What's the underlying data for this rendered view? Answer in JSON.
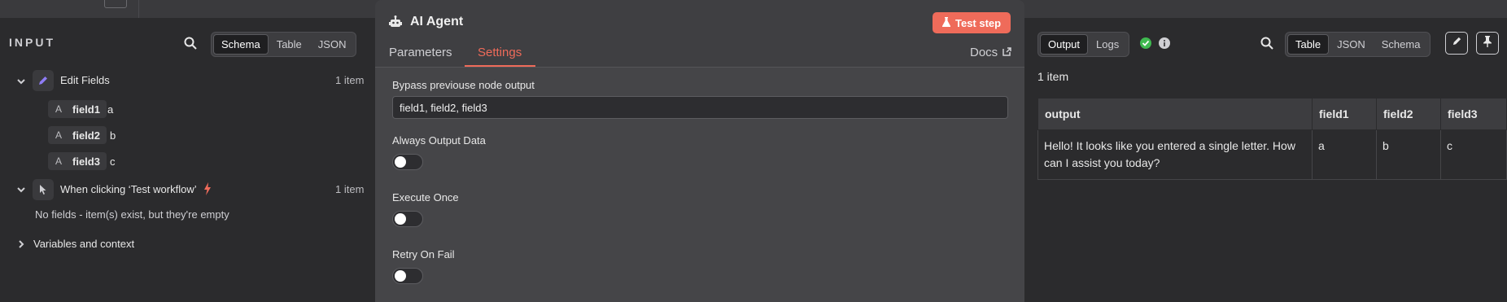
{
  "input_panel": {
    "title": "INPUT",
    "view_options": [
      "Schema",
      "Table",
      "JSON"
    ],
    "nodes": [
      {
        "name": "Edit Fields",
        "count": "1 item",
        "fields": [
          {
            "type": "A",
            "name": "field1",
            "value": "a"
          },
          {
            "type": "A",
            "name": "field2",
            "value": "b"
          },
          {
            "type": "A",
            "name": "field3",
            "value": "c"
          }
        ]
      },
      {
        "name": "When clicking ‘Test workflow’",
        "count": "1 item",
        "empty_message": "No fields - item(s) exist, but they're empty"
      }
    ],
    "variables_label": "Variables and context"
  },
  "node_modal": {
    "title": "AI Agent",
    "test_button": "Test step",
    "tabs": [
      "Parameters",
      "Settings"
    ],
    "active_tab": "Settings",
    "docs_link": "Docs",
    "settings": {
      "bypass_label": "Bypass previouse node output",
      "bypass_value": "field1, field2, field3",
      "always_output_label": "Always Output Data",
      "always_output_on": false,
      "execute_once_label": "Execute Once",
      "execute_once_on": false,
      "retry_label": "Retry On Fail",
      "retry_on": false
    }
  },
  "output_panel": {
    "tabs": [
      "Output",
      "Logs"
    ],
    "active_tab": "Output",
    "view_options": [
      "Table",
      "JSON",
      "Schema"
    ],
    "active_view": "Table",
    "item_count": "1 item",
    "table": {
      "columns": [
        "output",
        "field1",
        "field2",
        "field3"
      ],
      "rows": [
        [
          "Hello! It looks like you entered a single letter. How can I assist you today?",
          "a",
          "b",
          "c"
        ]
      ]
    }
  },
  "colors": {
    "accent": "#ef6b5a",
    "success": "#3fb950",
    "background": "#2b2b2d",
    "modal": "#454548"
  }
}
